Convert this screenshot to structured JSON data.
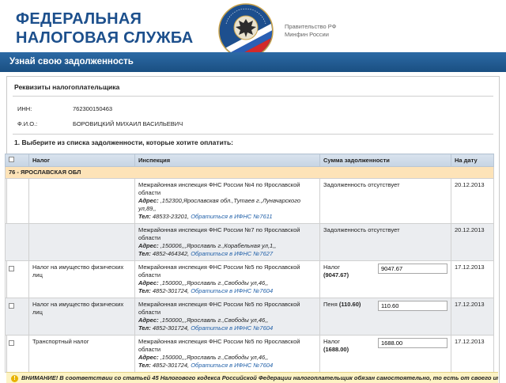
{
  "header": {
    "logo_line1": "ФЕДЕРАЛЬНАЯ",
    "logo_line2": "НАЛОГОВАЯ СЛУЖБА",
    "emblem_icon": "fns-eagle-emblem-icon",
    "gov_line1": "Правительство РФ",
    "gov_line2": "Минфин России"
  },
  "title": "Узнай свою задолженность",
  "taxpayer": {
    "heading": "Реквизиты налогоплательщика",
    "inn_label": "ИНН:",
    "inn_value": "762300150463",
    "fio_label": "Ф.И.О.:",
    "fio_value": "БОРОВИЦКИЙ МИХАИЛ ВАСИЛЬЕВИЧ"
  },
  "step1": "1. Выберите из списка задолженности, которые хотите оплатить:",
  "table": {
    "headers": {
      "tax": "Налог",
      "inspection": "Инспекция",
      "sum": "Сумма задолженности",
      "date": "На дату"
    },
    "region": "76 - ЯРОСЛАВСКАЯ ОБЛ",
    "rows": [
      {
        "tax": "",
        "insp_name": "Межрайонная инспекция ФНС России №4 по Ярославской области",
        "addr_label": "Адрес:",
        "addr": " ,152300,Ярославская обл.,Тутаев г.,Луначарского ул,89,,",
        "tel_label": "Тел:",
        "tel": " 48533-23201,",
        "link": "Обратиться в ИФНС №7611",
        "sum_text": "Задолженность отсутствует",
        "sum_amount": "",
        "input_value": "",
        "date": "20.12.2013"
      },
      {
        "tax": "",
        "insp_name": "Межрайонная инспекция ФНС России №7 по Ярославской области",
        "addr_label": "Адрес:",
        "addr": " ,150006,,,Ярославль г.,Корабельная ул,1,,",
        "tel_label": "Тел:",
        "tel": " 4852-464342,",
        "link": "Обратиться в ИФНС №7627",
        "sum_text": "Задолженность отсутствует",
        "sum_amount": "",
        "input_value": "",
        "date": "20.12.2013"
      },
      {
        "tax": "Налог на имущество физических лиц",
        "insp_name": "Межрайонная инспекция ФНС России №5 по Ярославской области",
        "addr_label": "Адрес:",
        "addr": " ,150000,,,Ярославль г.,Свободы ул,46,,",
        "tel_label": "Тел:",
        "tel": " 4852-301724,",
        "link": "Обратиться в ИФНС №7604",
        "sum_text": "Налог",
        "sum_amount": "(9047.67)",
        "input_value": "9047.67",
        "date": "17.12.2013"
      },
      {
        "tax": "Налог на имущество физических лиц",
        "insp_name": "Межрайонная инспекция ФНС России №5 по Ярославской области",
        "addr_label": "Адрес:",
        "addr": " ,150000,,,Ярославль г.,Свободы ул,46,,",
        "tel_label": "Тел:",
        "tel": " 4852-301724,",
        "link": "Обратиться в ИФНС №7604",
        "sum_text": "Пеня",
        "sum_amount": "(110.60)",
        "input_value": "110.60",
        "date": "17.12.2013"
      },
      {
        "tax": "Транспортный налог",
        "insp_name": "Межрайонная инспекция ФНС России №5 по Ярославской области",
        "addr_label": "Адрес:",
        "addr": " ,150000,,,Ярославль г.,Свободы ул,46,,",
        "tel_label": "Тел:",
        "tel": " 4852-301724,",
        "link": "Обратиться в ИФНС №7604",
        "sum_text": "Налог",
        "sum_amount": "(1688.00)",
        "input_value": "1688.00",
        "date": "17.12.2013"
      }
    ]
  },
  "warning": "ВНИМАНИЕ! В соответствии со статьей 45 Налогового кодекса Российской Федерации налогоплательщик обязан самостоятельно, то есть от своего имени"
}
